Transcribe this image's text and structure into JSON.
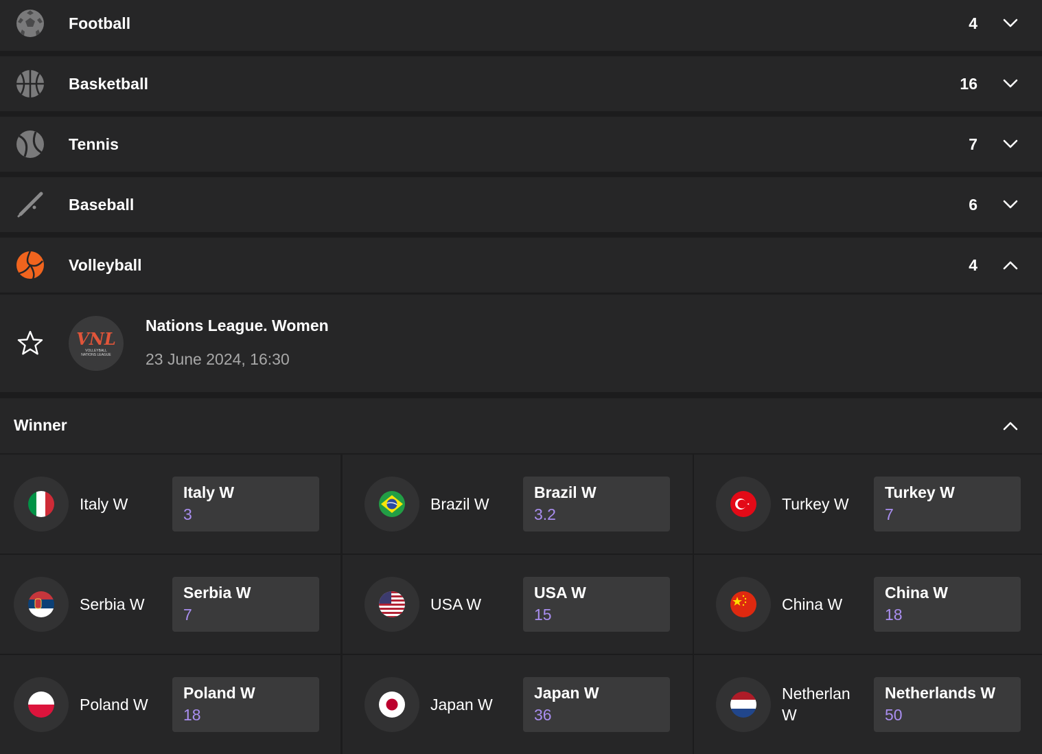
{
  "sports": [
    {
      "name": "Football",
      "count": "4",
      "icon": "football-icon",
      "expanded": false
    },
    {
      "name": "Basketball",
      "count": "16",
      "icon": "basketball-icon",
      "expanded": false
    },
    {
      "name": "Tennis",
      "count": "7",
      "icon": "tennis-icon",
      "expanded": false
    },
    {
      "name": "Baseball",
      "count": "6",
      "icon": "baseball-icon",
      "expanded": false
    },
    {
      "name": "Volleyball",
      "count": "4",
      "icon": "volleyball-icon",
      "expanded": true
    }
  ],
  "event": {
    "league": "Nations League. Women",
    "datetime": "23 June 2024, 16:30",
    "logo_text": "VNL",
    "logo_subtext": "VOLLEYBALL NATIONS LEAGUE"
  },
  "market": {
    "title": "Winner"
  },
  "selections": [
    {
      "team": "Italy W",
      "button_label": "Italy W",
      "odds": "3",
      "flag": "italy-flag"
    },
    {
      "team": "Brazil W",
      "button_label": "Brazil W",
      "odds": "3.2",
      "flag": "brazil-flag"
    },
    {
      "team": "Turkey W",
      "button_label": "Turkey W",
      "odds": "7",
      "flag": "turkey-flag"
    },
    {
      "team": "Serbia W",
      "button_label": "Serbia W",
      "odds": "7",
      "flag": "serbia-flag"
    },
    {
      "team": "USA W",
      "button_label": "USA W",
      "odds": "15",
      "flag": "usa-flag"
    },
    {
      "team": "China W",
      "button_label": "China W",
      "odds": "18",
      "flag": "china-flag"
    },
    {
      "team": "Poland W",
      "button_label": "Poland W",
      "odds": "18",
      "flag": "poland-flag"
    },
    {
      "team": "Japan W",
      "button_label": "Japan W",
      "odds": "36",
      "flag": "japan-flag"
    },
    {
      "team": "Netherlan W",
      "button_label": "Netherlands W",
      "odds": "50",
      "flag": "netherlands-flag"
    }
  ],
  "colors": {
    "background": "#1c1c1d",
    "row": "#262627",
    "button": "#3a3a3b",
    "odds": "#a98ef0",
    "volleyball_accent": "#f0641e"
  }
}
